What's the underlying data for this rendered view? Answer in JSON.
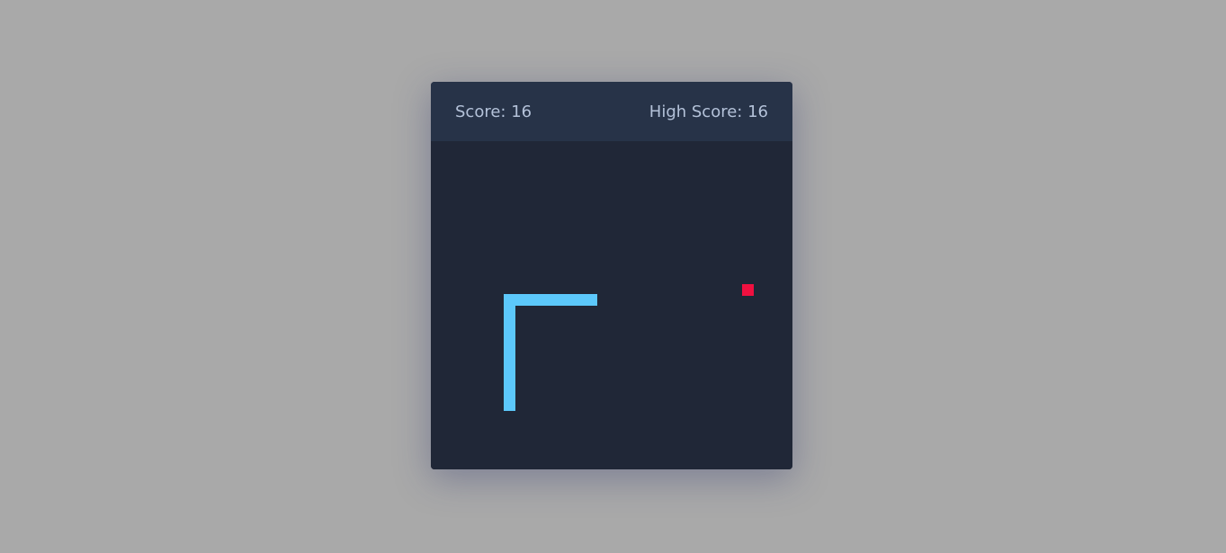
{
  "header": {
    "score_label": "Score:",
    "score_value": "16",
    "high_score_label": "High Score:",
    "high_score_value": "16"
  },
  "colors": {
    "page_background": "#a9a9a9",
    "board_background": "#202737",
    "header_background": "#273348",
    "header_text": "#b4c2d9",
    "snake": "#5cc8fb",
    "food": "#f01040"
  },
  "game": {
    "grid": {
      "cols": 31,
      "rows": 28
    },
    "snake": [
      [
        13,
        13
      ],
      [
        12,
        13
      ],
      [
        11,
        13
      ],
      [
        10,
        13
      ],
      [
        9,
        13
      ],
      [
        8,
        13
      ],
      [
        7,
        13
      ],
      [
        6,
        13
      ],
      [
        6,
        14
      ],
      [
        6,
        15
      ],
      [
        6,
        16
      ],
      [
        6,
        17
      ],
      [
        6,
        18
      ],
      [
        6,
        19
      ],
      [
        6,
        20
      ],
      [
        6,
        21
      ],
      [
        6,
        22
      ]
    ],
    "food": [
      26,
      12
    ]
  }
}
